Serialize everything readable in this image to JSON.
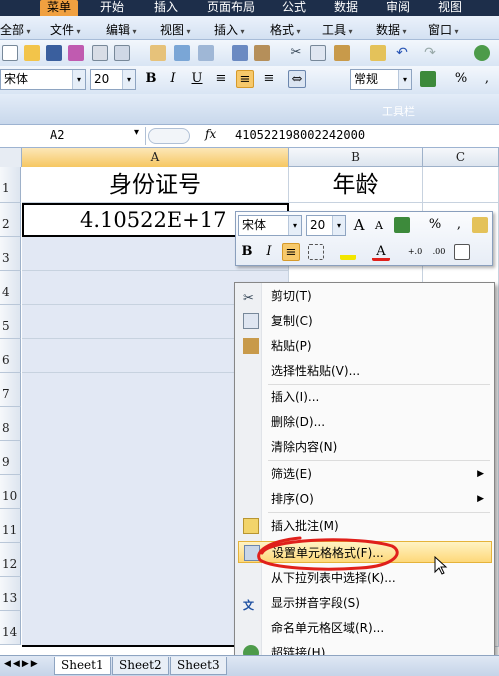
{
  "ribbon_tabs": [
    "菜单",
    "开始",
    "插入",
    "页面布局",
    "公式",
    "数据",
    "审阅",
    "视图"
  ],
  "menubar": [
    "全部",
    "文件",
    "编辑",
    "视图",
    "插入",
    "格式",
    "工具",
    "数据",
    "窗口"
  ],
  "toolbar": {
    "font_name": "宋体",
    "font_size": "20",
    "number_format": "常规",
    "bold_label": "B",
    "italic_label": "I",
    "underline_label": "U",
    "percent_label": "%",
    "comma_label": ","
  },
  "toolbar_group_label": "工具栏",
  "formula_bar": {
    "name_box": "A2",
    "fx_label": "fx",
    "formula": "410522198002242000"
  },
  "columns": [
    "A",
    "B",
    "C"
  ],
  "rows": [
    "1",
    "2",
    "3",
    "4",
    "5",
    "6",
    "7",
    "8",
    "9",
    "10",
    "11",
    "12",
    "13",
    "14"
  ],
  "cells": {
    "A1": "身份证号",
    "B1": "年龄",
    "A2": "4.10522E+17"
  },
  "mini_toolbar": {
    "font_name": "宋体",
    "font_size": "20",
    "grow_font": "A",
    "shrink_font": "A",
    "percent_label": "%",
    "comma_label": ",",
    "bold_label": "B",
    "italic_label": "I",
    "inc_decimal": "←.0 .00",
    "dec_decimal": ".00 →.0"
  },
  "context_menu": [
    {
      "label": "剪切(T)",
      "icon": "scissors-icon"
    },
    {
      "label": "复制(C)",
      "icon": "copy-icon"
    },
    {
      "label": "粘贴(P)",
      "icon": "paste-icon"
    },
    {
      "label": "选择性粘贴(V)...",
      "icon": ""
    },
    {
      "label": "插入(I)...",
      "icon": ""
    },
    {
      "label": "删除(D)...",
      "icon": ""
    },
    {
      "label": "清除内容(N)",
      "icon": ""
    },
    {
      "label": "筛选(E)",
      "icon": "",
      "submenu": true
    },
    {
      "label": "排序(O)",
      "icon": "",
      "submenu": true
    },
    {
      "label": "插入批注(M)",
      "icon": "comment-icon"
    },
    {
      "label": "设置单元格格式(F)...",
      "icon": "format-cells-icon",
      "highlighted": true
    },
    {
      "label": "从下拉列表中选择(K)...",
      "icon": ""
    },
    {
      "label": "显示拼音字段(S)",
      "icon": "phonetic-icon"
    },
    {
      "label": "命名单元格区域(R)...",
      "icon": ""
    },
    {
      "label": "超链接(H)...",
      "icon": "hyperlink-icon"
    }
  ],
  "sheet_tabs": [
    "Sheet1",
    "Sheet2",
    "Sheet3"
  ],
  "colors": {
    "highlight_circle": "#e0201b",
    "selection": "#e2e8f4",
    "ribbon_dark": "#1d2e4a",
    "active_tab": "#f0a040"
  }
}
